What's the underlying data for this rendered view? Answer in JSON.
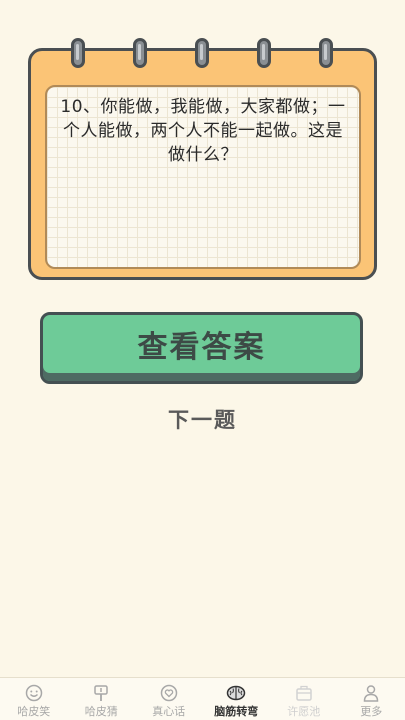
{
  "question": {
    "text": "10、你能做，我能做，大家都做；一个人能做，两个人不能一起做。这是做什么？"
  },
  "actions": {
    "answer_label": "查看答案",
    "next_label": "下一题"
  },
  "tabbar": {
    "items": [
      {
        "label": "哈皮笑",
        "icon": "smile-icon",
        "state": "normal"
      },
      {
        "label": "哈皮猜",
        "icon": "signpost-icon",
        "state": "normal"
      },
      {
        "label": "真心话",
        "icon": "heart-bubble-icon",
        "state": "normal"
      },
      {
        "label": "脑筋转弯",
        "icon": "brain-icon",
        "state": "active"
      },
      {
        "label": "许愿池",
        "icon": "wish-box-icon",
        "state": "disabled"
      },
      {
        "label": "更多",
        "icon": "person-icon",
        "state": "normal"
      }
    ]
  },
  "colors": {
    "background": "#fcf7e8",
    "notepad": "#fbc476",
    "button": "#6ecb98",
    "outline": "#4a4f52"
  }
}
